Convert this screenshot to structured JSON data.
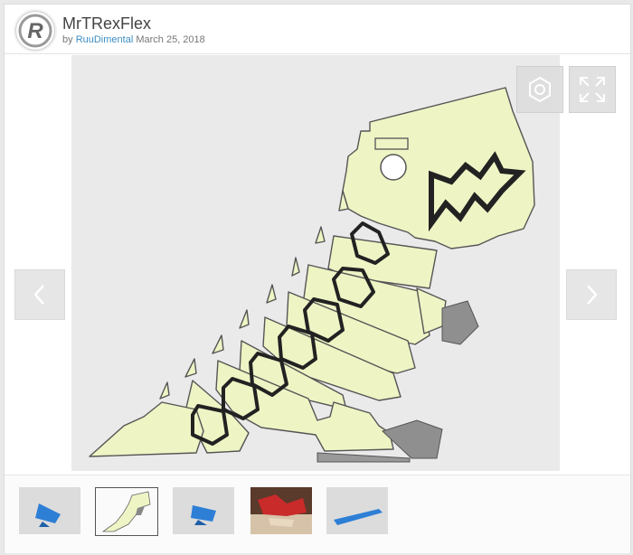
{
  "header": {
    "title": "MrTRexFlex",
    "by_label": "by",
    "author": "RuuDimental",
    "date": "March 25, 2018",
    "avatar_letter": "R"
  },
  "viewer": {
    "icons": [
      "hexagon-settings-icon",
      "expand-icon",
      "chevron-left-icon",
      "chevron-right-icon"
    ]
  },
  "thumbnails": [
    {
      "name": "blue-part-view-1",
      "active": false
    },
    {
      "name": "trex-flat-view",
      "active": true
    },
    {
      "name": "blue-part-view-2",
      "active": false
    },
    {
      "name": "red-printed-photo",
      "active": false
    },
    {
      "name": "blue-part-side-view",
      "active": false
    }
  ],
  "colors": {
    "model_fill": "#eef4c4",
    "model_stroke": "#555555",
    "viewer_bg": "#eaeaea",
    "feet_gray": "#8f8f8f",
    "author_link": "#3c8dc4",
    "thumb_blue": "#2d7fd6",
    "thumb_red": "#c92a2a"
  }
}
